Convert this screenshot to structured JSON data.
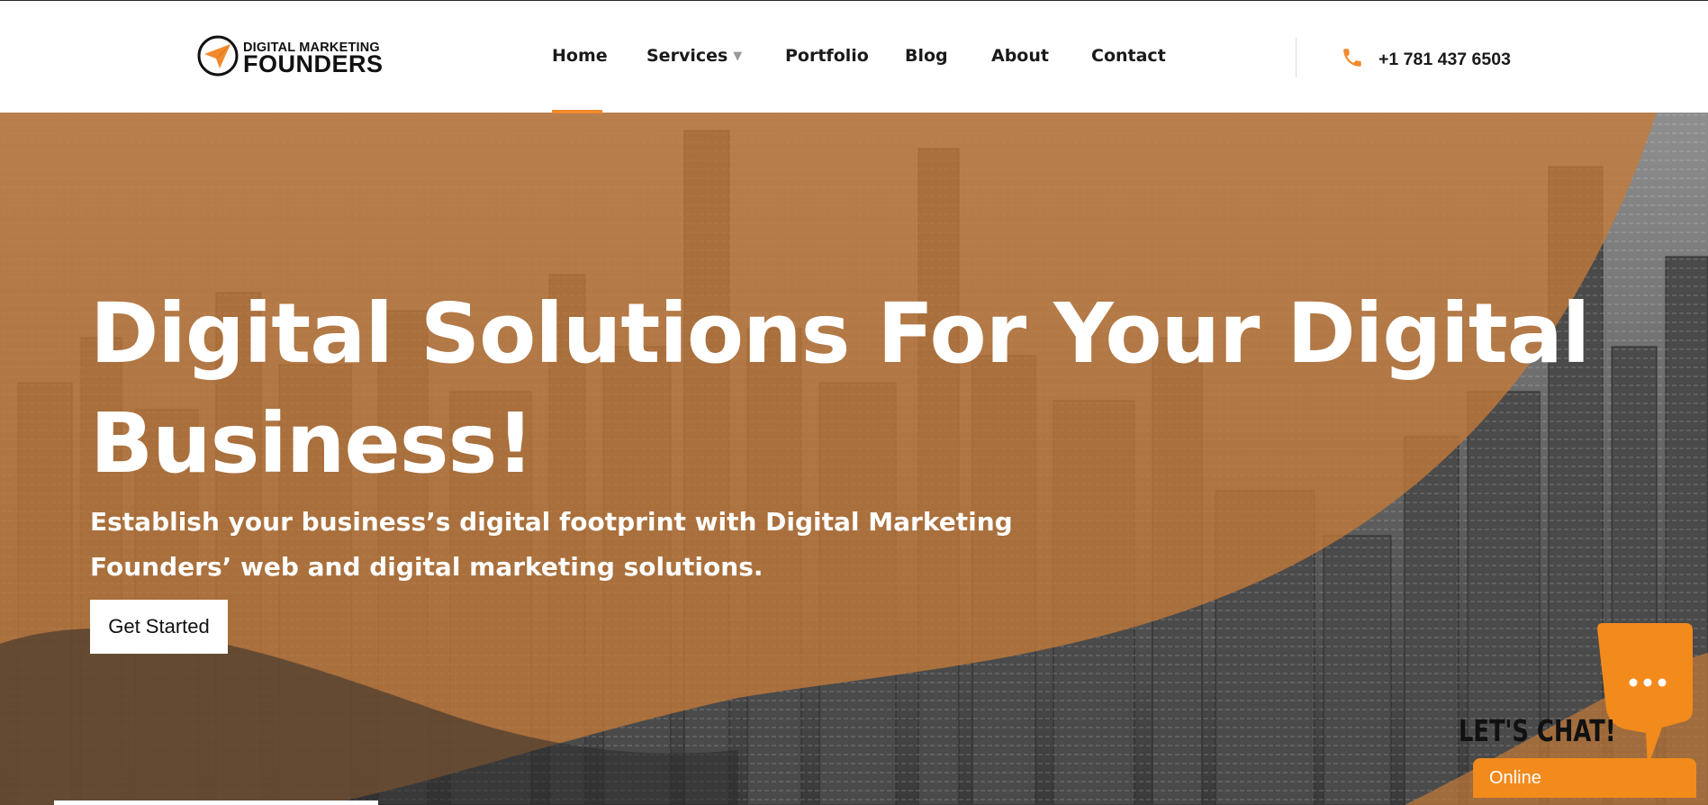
{
  "brand": {
    "name_top": "DIGITAL MARKETING",
    "name_bottom": "FOUNDERS",
    "logo_icon": "paper-plane-icon",
    "accent_color": "#f28a2c"
  },
  "nav": {
    "items": [
      {
        "label": "Home",
        "active": true
      },
      {
        "label": "Services",
        "has_dropdown": true
      },
      {
        "label": "Portfolio"
      },
      {
        "label": "Blog"
      },
      {
        "label": "About"
      },
      {
        "label": "Contact"
      }
    ],
    "dropdown_icon": "caret-down-icon"
  },
  "contact": {
    "phone": "+1 781 437 6503",
    "phone_icon": "phone-icon"
  },
  "hero": {
    "title": "Digital Solutions For Your Digital Business!",
    "subtitle": "Establish your business’s digital footprint with Digital Marketing Founders’ web and digital marketing solutions.",
    "cta_label": "Get Started",
    "overlay_color": "#b87033",
    "background": "aerial-city-skyline"
  },
  "chat": {
    "title": "LET'S CHAT!",
    "status": "Online",
    "bubble_icon": "chat-bubble-icon",
    "color": "#f38a1c"
  }
}
